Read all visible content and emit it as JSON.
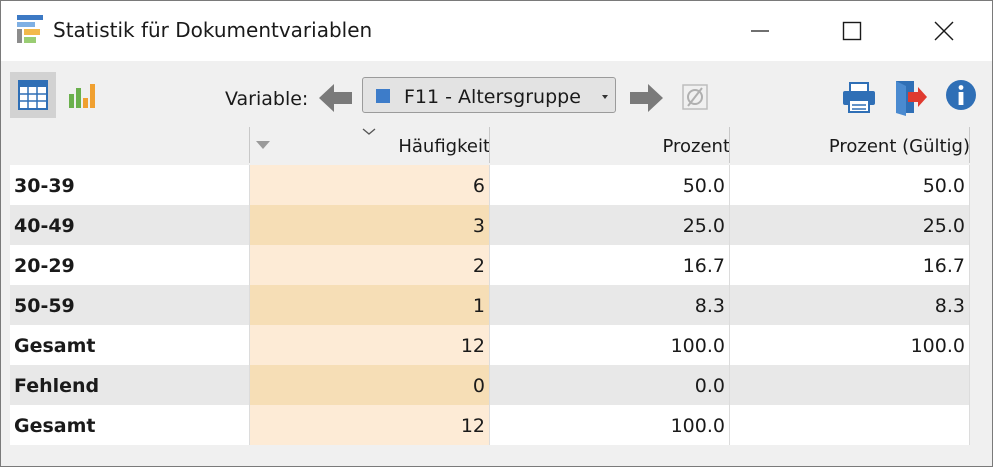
{
  "window": {
    "title": "Statistik für Dokumentvariablen"
  },
  "toolbar": {
    "variable_label": "Variable:",
    "selected_variable": "F11 - Altersgruppe",
    "selected_variable_color": "#3d7cc9"
  },
  "table": {
    "columns": [
      "",
      "Häufigkeit",
      "Prozent",
      "Prozent (Gültig)"
    ],
    "rows": [
      [
        "30-39",
        "6",
        "50.0",
        "50.0"
      ],
      [
        "40-49",
        "3",
        "25.0",
        "25.0"
      ],
      [
        "20-29",
        "2",
        "16.7",
        "16.7"
      ],
      [
        "50-59",
        "1",
        "8.3",
        "8.3"
      ],
      [
        "Gesamt",
        "12",
        "100.0",
        "100.0"
      ],
      [
        "Fehlend",
        "0",
        "0.0",
        ""
      ],
      [
        "Gesamt",
        "12",
        "100.0",
        ""
      ]
    ]
  },
  "colors": {
    "frequency_column_light": "#fdebd6",
    "frequency_column_dark": "#f6deb6",
    "alt_row": "#e8e8e8",
    "accent_blue": "#2f6fb6",
    "export_arrow": "#e03a2f",
    "chart_green": "#6ab04c",
    "chart_orange": "#f0a030"
  },
  "icons": {
    "app": "app-icon",
    "minimize": "minimize-icon",
    "maximize": "maximize-icon",
    "close": "close-icon",
    "table_view": "table-grid-icon",
    "chart_view": "bar-chart-icon",
    "previous": "arrow-left-icon",
    "next": "arrow-right-icon",
    "filter": "empty-set-icon",
    "print": "printer-icon",
    "export": "export-icon",
    "info": "info-icon"
  }
}
